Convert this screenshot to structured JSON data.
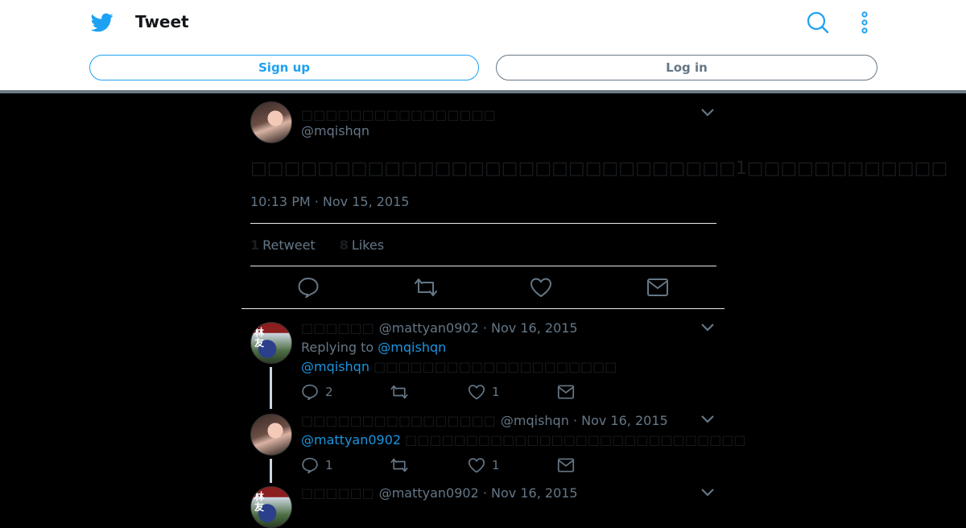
{
  "header": {
    "title": "Tweet",
    "signup_label": "Sign up",
    "login_label": "Log in",
    "brand_color": "#1da1f2"
  },
  "tweet": {
    "name": "□□□□□□□□□□□□□□□□",
    "handle": "@mqishqn",
    "text": "□□□□□□□□□□□□□□□□□□□□□□□□□□□□□1□□□□□□□□□□□□",
    "timestamp": "10:13 PM · Nov 15, 2015",
    "retweets_count": "1",
    "retweets_label": "Retweet",
    "likes_count": "8",
    "likes_label": "Likes"
  },
  "replies": [
    {
      "name": "□□□□□□",
      "handle": "@mattyan0902",
      "date": "· Nov 16, 2015",
      "replying_prefix": "Replying to",
      "replying_to": "@mqishqn",
      "mention": "@mqishqn",
      "text": "□□□□□□□□□□□□□□□□□□□□",
      "reply_count": "2",
      "like_count": "1",
      "avatar_text": "林友"
    },
    {
      "name": "□□□□□□□□□□□□□□□□",
      "handle": "@mqishqn",
      "date": "· Nov 16, 2015",
      "mention": "@mattyan0902",
      "text": "□□□□□□□□□□□□□□□□□□□□□□□□□□□□",
      "reply_count": "1",
      "like_count": "1"
    },
    {
      "name": "□□□□□□",
      "handle": "@mattyan0902",
      "date": "· Nov 16, 2015",
      "avatar_text": "林友"
    }
  ]
}
